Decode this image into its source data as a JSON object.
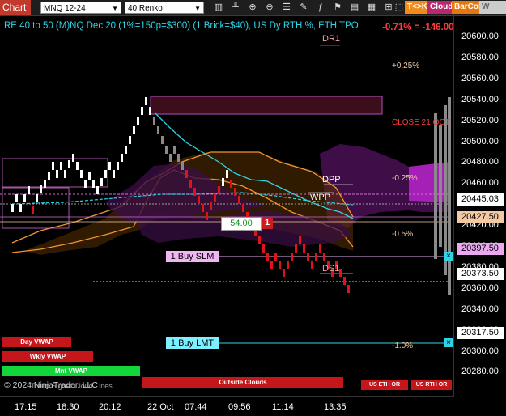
{
  "toolbar": {
    "app_label": "Chart",
    "instrument": "MNQ 12-24",
    "bar_type": "40 Renko",
    "icons": [
      "bar-style-icon",
      "chart-style-icon",
      "crosshair-icon",
      "zoom-in-icon",
      "zoom-out-icon",
      "properties-icon",
      "drawing-tools-icon",
      "indicators-icon",
      "strategies-icon",
      "templates-icon",
      "data-box-icon",
      "order-panel-icon",
      "chart-trader-icon",
      "scroll-icon"
    ],
    "buttons": {
      "tk": "T<>K",
      "cloud": "Cloud",
      "barcol": "BarCol",
      "vwap": "W VWAP"
    }
  },
  "header": {
    "title": "RE 40 to 50 (M)NQ Dec 20 (1%=150p=$300) (1 Brick=$40), US Dy RTH %, ETH TPO",
    "pnl": "-0.71% = -146.00"
  },
  "price_axis": {
    "ticks": [
      "20600.00",
      "20580.00",
      "20560.00",
      "20540.00",
      "20520.00",
      "20500.00",
      "20480.00",
      "20460.00",
      "20420.00",
      "20400.00",
      "20380.00",
      "20360.00",
      "20340.00",
      "20320.00",
      "20300.00",
      "20280.00"
    ],
    "highlights": [
      {
        "value": "20445.03",
        "bg": "#ffffff",
        "fg": "#000000"
      },
      {
        "value": "20427.50",
        "bg": "#f3c9a4",
        "fg": "#000000"
      },
      {
        "value": "20397.50",
        "bg": "#e9a8ef",
        "fg": "#000000"
      },
      {
        "value": "20373.50",
        "bg": "#ffffff",
        "fg": "#000000"
      },
      {
        "value": "20317.50",
        "bg": "#ffffff",
        "fg": "#000000"
      }
    ]
  },
  "time_axis": [
    "17:15",
    "18:30",
    "20:12",
    "22 Oct",
    "07:44",
    "09:56",
    "11:14",
    "13:35"
  ],
  "levels": {
    "dr1": "DR1",
    "dpp": "DPP",
    "wpp": "WPP",
    "ds1": "DS1",
    "pct_pos": "+0.25%",
    "pct_neg1": "-0.25%",
    "pct_neg2": "-0.5%",
    "pct_neg3": "-1.0%",
    "close_label": "CLOSE 21 OCT"
  },
  "orders": {
    "position_price": "54.00",
    "position_qty": "1",
    "buy_slm": "1 Buy SLM",
    "buy_lmt": "1 Buy LMT",
    "cancel_glyph": "×"
  },
  "buttons_bottom": {
    "day_vwap": "Day VWAP",
    "wkly_vwap": "Wkly VWAP",
    "mnt_vwap": "Mnt VWAP",
    "outside_clouds": "Outside Clouds",
    "us_eth_or": "US ETH OR",
    "us_rth_or": "US RTH OR"
  },
  "copyright": "© 2024 NinjaTrader, LLC",
  "overlay_text": "Trend Signal Cloud Lines",
  "colors": {
    "up": "#ffffff",
    "down": "#e0121a",
    "cyan": "#2fd3e6",
    "orange": "#f29530",
    "magenta": "#a520b6"
  }
}
